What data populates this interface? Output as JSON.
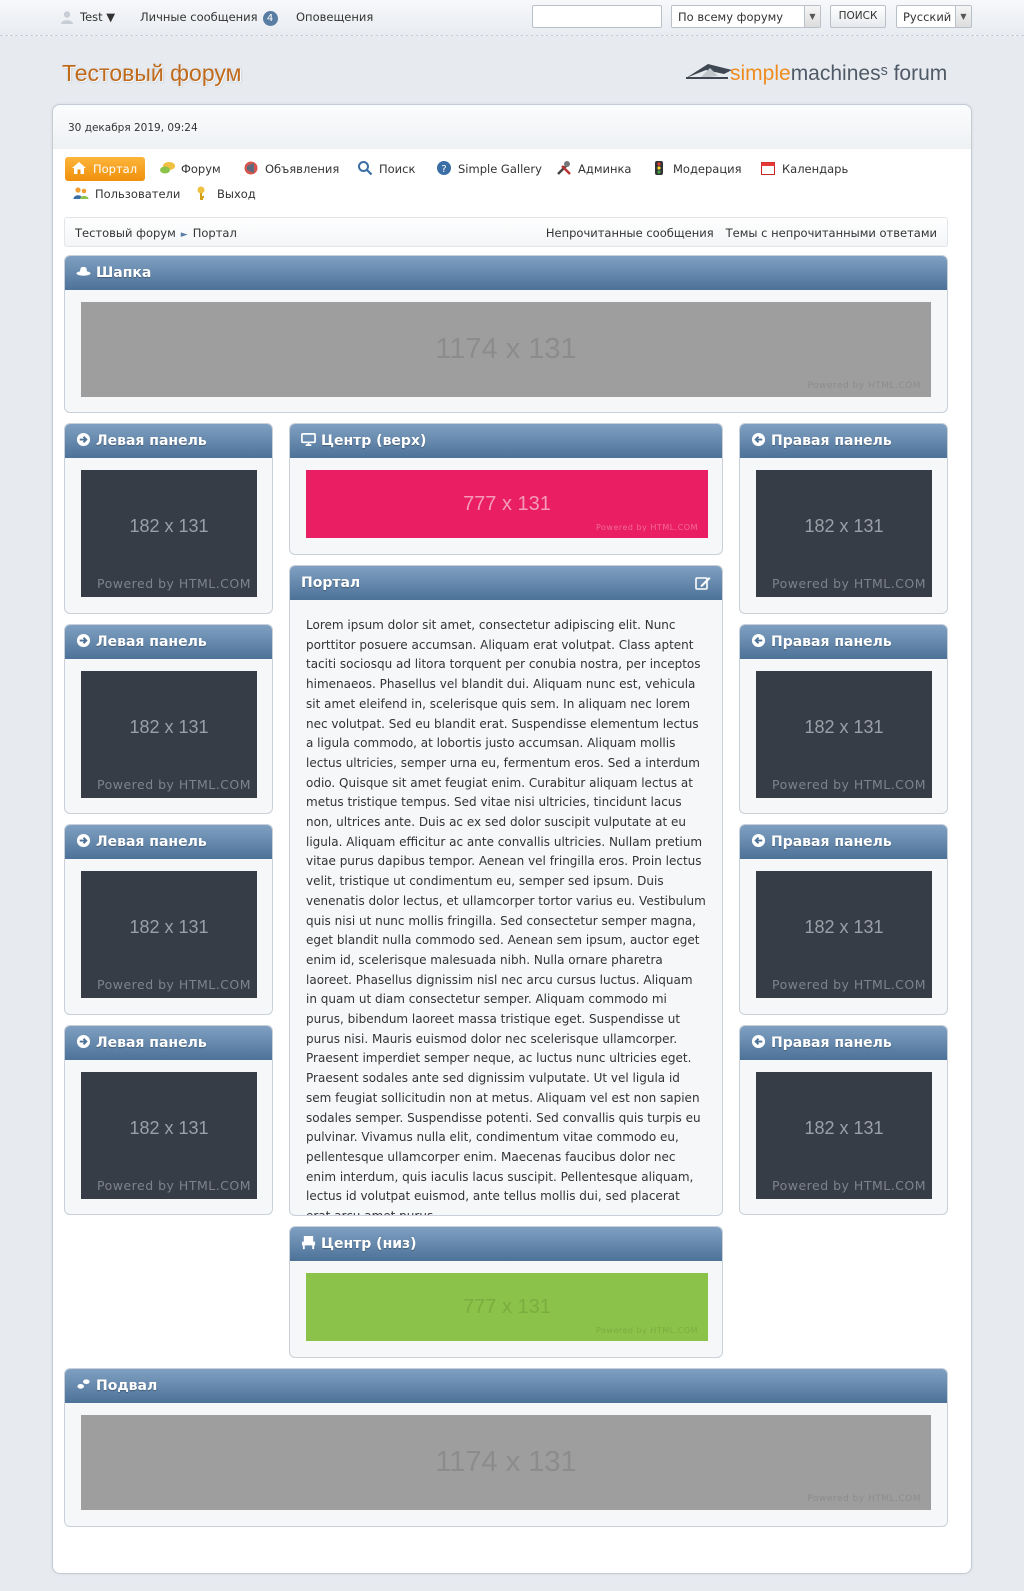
{
  "topbar": {
    "user": "Test ▼",
    "messages_label": "Личные сообщения",
    "messages_count": "4",
    "notifications": "Оповещения",
    "search_value": "",
    "scope": "По всему форуму",
    "search_button": "ПОИСК",
    "language": "Русский"
  },
  "header": {
    "forum_title": "Тестовый форум",
    "logo_text_1": "simple",
    "logo_text_2": "machines",
    "logo_text_3": "forum"
  },
  "date": "30 декабря 2019, 09:24",
  "menu": {
    "portal": "Портал",
    "forum": "Форум",
    "ads": "Объявления",
    "search": "Поиск",
    "gallery": "Simple Gallery",
    "admin": "Админка",
    "moderation": "Модерация",
    "calendar": "Календарь",
    "members": "Пользователи",
    "logout": "Выход"
  },
  "breadcrumb": {
    "root": "Тестовый форум",
    "sep": "►",
    "current": "Портал",
    "unread": "Непрочитанные сообщения",
    "replies": "Темы с непрочитанными ответами"
  },
  "blocks": {
    "header_title": "Шапка",
    "left_title": "Левая панель",
    "right_title": "Правая панель",
    "center_top_title": "Центр (верх)",
    "portal_title": "Портал",
    "center_bottom_title": "Центр (низ)",
    "footer_title": "Подвал"
  },
  "banners": {
    "wide_size": "1174 x 131",
    "side_size": "182 x 131",
    "center_size": "777 x 131",
    "powered": "Powered by HTML.COM"
  },
  "portal_text": "Lorem ipsum dolor sit amet, consectetur adipiscing elit. Nunc porttitor posuere accumsan. Aliquam erat volutpat. Class aptent taciti sociosqu ad litora torquent per conubia nostra, per inceptos himenaeos. Phasellus vel blandit dui. Aliquam nunc est, vehicula sit amet eleifend in, scelerisque quis sem. In aliquam nec lorem nec volutpat. Sed eu blandit erat. Suspendisse elementum lectus a ligula commodo, at lobortis justo accumsan. Aliquam mollis lectus ultricies, semper urna eu, fermentum eros. Sed a interdum odio. Quisque sit amet feugiat enim. Curabitur aliquam lectus at metus tristique tempus. Sed vitae nisi ultricies, tincidunt lacus non, ultrices ante. Duis ac ex sed dolor suscipit vulputate at eu ligula. Aliquam efficitur ac ante convallis ultricies. Nullam pretium vitae purus dapibus tempor. Aenean vel fringilla eros. Proin lectus velit, tristique ut condimentum eu, semper sed ipsum. Duis venenatis dolor lectus, et ullamcorper tortor varius eu. Vestibulum quis nisi ut nunc mollis fringilla. Sed consectetur semper magna, eget blandit nulla commodo sed. Aenean sem ipsum, auctor eget enim id, scelerisque malesuada nibh. Nulla ornare pharetra laoreet. Phasellus dignissim nisl nec arcu cursus luctus. Aliquam in quam ut diam consectetur semper. Aliquam commodo mi purus, bibendum laoreet massa tristique eget. Suspendisse ut purus nisi. Mauris euismod dolor nec scelerisque ullamcorper. Praesent imperdiet semper neque, ac luctus nunc ultricies eget. Praesent sodales ante sed dignissim vulputate. Ut vel ligula id sem feugiat sollicitudin non at metus. Aliquam vel est non sapien sodales semper. Suspendisse potenti. Sed convallis quis turpis eu pulvinar. Vivamus nulla elit, condimentum vitae commodo eu, pellentesque ullamcorper enim. Maecenas faucibus dolor nec enim interdum, quis iaculis lacus suscipit. Pellentesque aliquam, lectus id volutpat euismod, ante tellus mollis dui, sed placerat erat arcu amet purus.",
  "colors": {
    "accent": "#f0900c",
    "header_blue": "#5a7ea3",
    "title_orange": "#c06a1c"
  }
}
